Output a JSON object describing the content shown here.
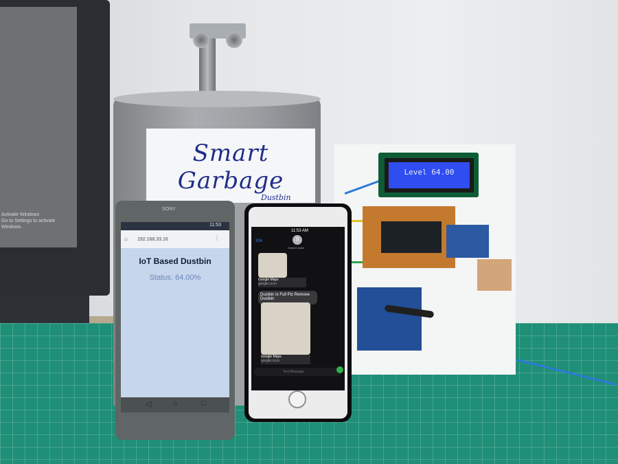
{
  "scene": {
    "dustbin_label": {
      "title": "Smart Garbage",
      "subtitle": "Dustbin"
    },
    "lcd_display": {
      "text": "Level 64.00"
    },
    "monitor": {
      "text": "Activate Windows\nGo to Settings to activate Windows."
    }
  },
  "android_phone": {
    "brand": "SONY",
    "status_time": "11:53",
    "url": "192.168.33.16",
    "page_title": "IoT Based Dustbin",
    "status_text": "Status: 64.00%",
    "nav_icons": [
      "back-icon",
      "home-icon",
      "recents-icon"
    ]
  },
  "iphone": {
    "status_time": "11:53 AM",
    "back_count": "304",
    "contact_initial": "S",
    "contact_name": "Sameer Alam",
    "messages": [
      {
        "type": "map",
        "title": "Google Maps",
        "source": "google.co.in"
      },
      {
        "type": "text",
        "text": "Dustbin Is Full Plz Remove Dustbin"
      },
      {
        "type": "map",
        "title": "Google Maps",
        "source": "google.co.in"
      }
    ],
    "compose_placeholder": "Text Message"
  },
  "colors": {
    "lcd_background": "#2f4df0",
    "cutting_mat": "#1f8f77",
    "label_ink": "#1f2d8a",
    "browser_status": "#6a86b8"
  }
}
